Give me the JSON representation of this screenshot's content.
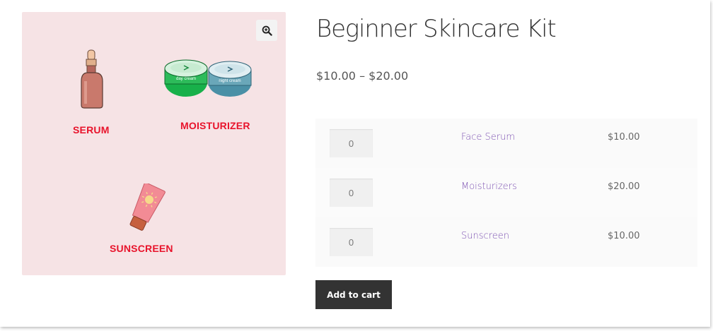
{
  "product": {
    "title": "Beginner Skincare Kit",
    "price_range": "$10.00 – $20.00"
  },
  "gallery": {
    "zoom_icon": "magnifier-plus-icon",
    "labels": {
      "serum": "SERUM",
      "moisturizer": "MOISTURIZER",
      "sunscreen": "SUNSCREEN"
    },
    "jar_labels": {
      "day": "day cream",
      "night": "night cream"
    },
    "colors": {
      "background": "#f6e3e5",
      "label": "#e8132b"
    }
  },
  "grouped_items": [
    {
      "qty": "0",
      "name": "Face Serum",
      "price": "$10.00"
    },
    {
      "qty": "0",
      "name": "Moisturizers",
      "price": "$20.00"
    },
    {
      "qty": "0",
      "name": "Sunscreen",
      "price": "$10.00"
    }
  ],
  "actions": {
    "add_to_cart": "Add to cart"
  },
  "colors": {
    "link": "#7f54b3",
    "button": "#333333"
  }
}
